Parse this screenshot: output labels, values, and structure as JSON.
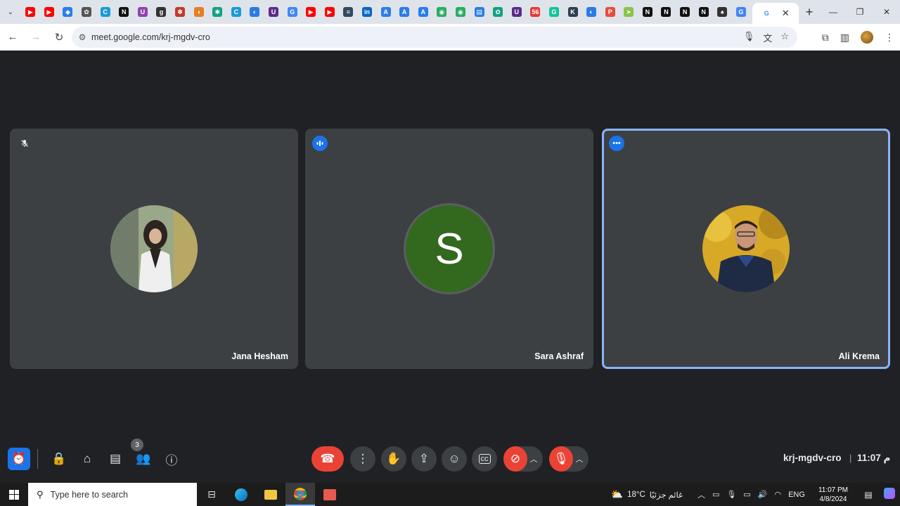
{
  "browser": {
    "tabs": [
      {
        "icon": "youtube-icon",
        "color": "#ff0000",
        "glyph": "▶"
      },
      {
        "icon": "youtube-icon",
        "color": "#ff0000",
        "glyph": "▶"
      },
      {
        "icon": "drive-icon",
        "color": "#2b7de9",
        "glyph": "◆"
      },
      {
        "icon": "chatgpt-icon",
        "color": "#555555",
        "glyph": "✿"
      },
      {
        "icon": "site-c-icon",
        "color": "#1a9bd7",
        "glyph": "C"
      },
      {
        "icon": "notion-icon",
        "color": "#111111",
        "glyph": "N"
      },
      {
        "icon": "site-u-icon",
        "color": "#8e44ad",
        "glyph": "U"
      },
      {
        "icon": "site-gw-icon",
        "color": "#333333",
        "glyph": "g"
      },
      {
        "icon": "site-flower-icon",
        "color": "#c0392b",
        "glyph": "✽"
      },
      {
        "icon": "site-ribbon-icon",
        "color": "#e67e22",
        "glyph": "◖"
      },
      {
        "icon": "site-tree-icon",
        "color": "#16a085",
        "glyph": "✱"
      },
      {
        "icon": "site-c-icon",
        "color": "#1a9bd7",
        "glyph": "C"
      },
      {
        "icon": "site-half-icon",
        "color": "#2c7be5",
        "glyph": "◐"
      },
      {
        "icon": "site-u-icon",
        "color": "#5b2c8a",
        "glyph": "U"
      },
      {
        "icon": "google-icon",
        "color": "#4285f4",
        "glyph": "G"
      },
      {
        "icon": "youtube-icon",
        "color": "#ff0000",
        "glyph": "▶"
      },
      {
        "icon": "youtube-icon",
        "color": "#ff0000",
        "glyph": "▶"
      },
      {
        "icon": "doc-icon",
        "color": "#34495e",
        "glyph": "≡"
      },
      {
        "icon": "linkedin-icon",
        "color": "#0a66c2",
        "glyph": "in"
      },
      {
        "icon": "translate-icon",
        "color": "#2b7de9",
        "glyph": "A"
      },
      {
        "icon": "translate-icon",
        "color": "#2b7de9",
        "glyph": "A"
      },
      {
        "icon": "translate-icon",
        "color": "#2b7de9",
        "glyph": "A"
      },
      {
        "icon": "android-icon",
        "color": "#27ae60",
        "glyph": "◉"
      },
      {
        "icon": "android-icon",
        "color": "#27ae60",
        "glyph": "◉"
      },
      {
        "icon": "file-icon",
        "color": "#2b7de9",
        "glyph": "▤"
      },
      {
        "icon": "chatgpt-icon",
        "color": "#10a37f",
        "glyph": "✿"
      },
      {
        "icon": "site-u-icon",
        "color": "#5b2c8a",
        "glyph": "U"
      },
      {
        "icon": "site-badge-icon",
        "color": "#e53935",
        "glyph": "56"
      },
      {
        "icon": "grammarly-icon",
        "color": "#15c39a",
        "glyph": "G"
      },
      {
        "icon": "site-k-icon",
        "color": "#2c3e50",
        "glyph": "K"
      },
      {
        "icon": "site-half-icon",
        "color": "#2c7be5",
        "glyph": "◐"
      },
      {
        "icon": "site-p-icon",
        "color": "#e74c3c",
        "glyph": "P"
      },
      {
        "icon": "site-arrow-icon",
        "color": "#8bc34a",
        "glyph": "➤"
      },
      {
        "icon": "notion-icon",
        "color": "#111111",
        "glyph": "N"
      },
      {
        "icon": "notion-icon",
        "color": "#111111",
        "glyph": "N"
      },
      {
        "icon": "notion-icon",
        "color": "#111111",
        "glyph": "N"
      },
      {
        "icon": "notion-icon",
        "color": "#111111",
        "glyph": "N"
      },
      {
        "icon": "site-hat-icon",
        "color": "#333333",
        "glyph": "♠"
      },
      {
        "icon": "google-icon",
        "color": "#4285f4",
        "glyph": "G"
      }
    ],
    "url": "meet.google.com/krj-mgdv-cro"
  },
  "meet": {
    "participants": [
      {
        "name": "Jana Hesham",
        "status": "muted"
      },
      {
        "name": "Sara Ashraf",
        "status": "speaking",
        "initial": "S"
      },
      {
        "name": "Ali Krema",
        "status": "more-options"
      }
    ],
    "people_count": "3",
    "meeting_code": "krj-mgdv-cro",
    "separator": "|",
    "clock": "11:07 م"
  },
  "taskbar": {
    "search_placeholder": "Type here to search",
    "weather_temp": "18°C",
    "weather_text": "غائم جزئيًا",
    "language": "ENG",
    "time": "11:07 PM",
    "date": "4/8/2024"
  },
  "colors": {
    "accent": "#1a73e8",
    "end_call": "#ea4335",
    "tile_bg": "#3c4043",
    "page_bg": "#202124",
    "active_border": "#8ab4f8",
    "avatar_s": "#33691e"
  }
}
